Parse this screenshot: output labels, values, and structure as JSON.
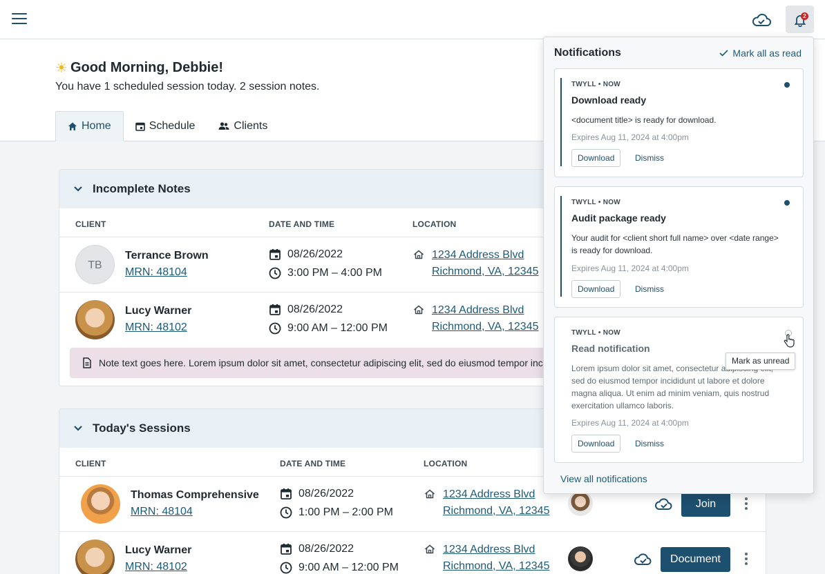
{
  "topbar": {
    "menu_icon": "hamburger-menu-icon",
    "sync_icon": "cloud-sync-icon",
    "bell_icon": "bell-icon",
    "bell_badge": "2"
  },
  "header": {
    "greeting_emoji": "☀",
    "greeting": "Good Morning, Debbie!",
    "subtitle": "You have 1 scheduled session today. 2 session notes.",
    "tabs": [
      {
        "label": "Home",
        "icon": "home-icon",
        "active": true
      },
      {
        "label": "Schedule",
        "icon": "calendar-icon",
        "active": false
      },
      {
        "label": "Clients",
        "icon": "people-icon",
        "active": false
      }
    ]
  },
  "incomplete": {
    "title": "Incomplete Notes",
    "columns": [
      "CLIENT",
      "DATE AND TIME",
      "LOCATION"
    ],
    "rows": [
      {
        "initials": "TB",
        "name": "Terrance Brown",
        "mrn": "MRN: 48104",
        "date": "08/26/2022",
        "time": "3:00 PM – 4:00 PM",
        "address1": "1234 Address Blvd",
        "address2": "Richmond, VA, 12345"
      },
      {
        "initials": "",
        "name": "Lucy Warner",
        "mrn": "MRN: 48102",
        "date": "08/26/2022",
        "time": "9:00 AM – 12:00 PM",
        "address1": "1234 Address Blvd",
        "address2": "Richmond, VA, 12345"
      }
    ],
    "note_text": "Note text goes here. Lorem ipsum dolor sit amet, consectetur adipiscing elit, sed do eiusmod tempor incididunt ut labore et dolore magna aliqua."
  },
  "sessions": {
    "title": "Today's Sessions",
    "columns": [
      "CLIENT",
      "DATE AND TIME",
      "LOCATION"
    ],
    "rows": [
      {
        "name": "Thomas Comprehensive",
        "mrn": "MRN: 48104",
        "date": "08/26/2022",
        "time": "1:00 PM – 2:00 PM",
        "address1": "1234 Address Blvd",
        "address2": "Richmond, VA, 12345",
        "action": "Join"
      },
      {
        "name": "Lucy Warner",
        "mrn": "MRN: 48102",
        "date": "08/26/2022",
        "time": "9:00 AM – 12:00 PM",
        "address1": "1234 Address Blvd",
        "address2": "Richmond, VA, 12345",
        "action": "Document"
      }
    ]
  },
  "notifications": {
    "title": "Notifications",
    "mark_all": "Mark all as read",
    "items": [
      {
        "source": "TWYLL  •  NOW",
        "title": "Download ready",
        "body": "<document title> is ready for download.",
        "expires": "Expires Aug 11, 2024 at 4:00pm",
        "download": "Download",
        "dismiss": "Dismiss",
        "unread": true
      },
      {
        "source": "TWYLL  •  NOW",
        "title": "Audit package ready",
        "body": "Your audit for <client short full name> over <date range> is ready for download.",
        "expires": "Expires Aug 11, 2024 at 4:00pm",
        "download": "Download",
        "dismiss": "Dismiss",
        "unread": true
      },
      {
        "source": "TWYLL  •  NOW",
        "title": "Read notification",
        "body": "Lorem ipsum dolor sit amet, consectetur adipiscing elit, sed do eiusmod tempor incididunt ut labore et dolore magna aliqua. Ut enim ad minim veniam, quis nostrud exercitation ullamco laboris.",
        "expires": "Expires Aug 11, 2024 at 4:00pm",
        "download": "Download",
        "dismiss": "Dismiss",
        "unread": false
      }
    ],
    "tooltip": "Mark as unread",
    "view_all": "View all notifications"
  },
  "colors": {
    "primary": "#1d4f6e",
    "link": "#1d5a78",
    "card_header_bg": "#eaf1f6",
    "note_bg": "#ecdfe8",
    "badge": "#c62828"
  }
}
